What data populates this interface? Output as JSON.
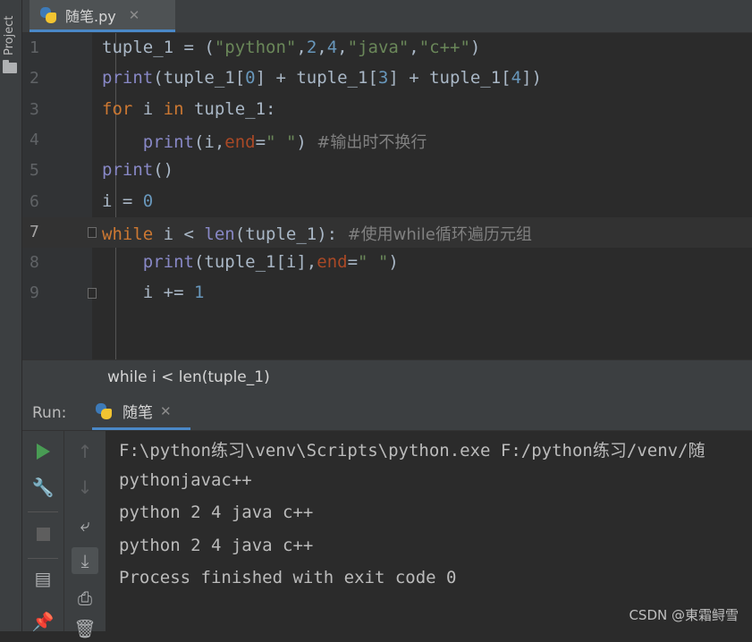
{
  "sidebar": {
    "project_label": "Project"
  },
  "editor_tab": {
    "filename": "随笔.py",
    "close": "✕"
  },
  "editor": {
    "current_line": 7,
    "lines": [
      {
        "n": "1",
        "tokens": [
          [
            "t",
            "tuple_1 = ("
          ],
          [
            "s",
            "\"python\""
          ],
          [
            "t",
            ","
          ],
          [
            "n",
            "2"
          ],
          [
            "t",
            ","
          ],
          [
            "n",
            "4"
          ],
          [
            "t",
            ","
          ],
          [
            "s",
            "\"java\""
          ],
          [
            "t",
            ","
          ],
          [
            "s",
            "\"c++\""
          ],
          [
            "t",
            ")"
          ]
        ]
      },
      {
        "n": "2",
        "tokens": [
          [
            "b",
            "print"
          ],
          [
            "t",
            "(tuple_1["
          ],
          [
            "n",
            "0"
          ],
          [
            "t",
            "] + tuple_1["
          ],
          [
            "n",
            "3"
          ],
          [
            "t",
            "] + tuple_1["
          ],
          [
            "n",
            "4"
          ],
          [
            "t",
            "])"
          ]
        ]
      },
      {
        "n": "3",
        "tokens": [
          [
            "k",
            "for"
          ],
          [
            "t",
            " i "
          ],
          [
            "k",
            "in"
          ],
          [
            "t",
            " tuple_1:"
          ]
        ]
      },
      {
        "n": "4",
        "tokens": [
          [
            "t",
            "    "
          ],
          [
            "b",
            "print"
          ],
          [
            "t",
            "(i,"
          ],
          [
            "a",
            "end"
          ],
          [
            "t",
            "="
          ],
          [
            "s",
            "\" \""
          ],
          [
            "t",
            ") "
          ],
          [
            "c",
            "#输出时不换行"
          ]
        ]
      },
      {
        "n": "5",
        "tokens": [
          [
            "b",
            "print"
          ],
          [
            "t",
            "()"
          ]
        ]
      },
      {
        "n": "6",
        "tokens": [
          [
            "t",
            "i = "
          ],
          [
            "n",
            "0"
          ]
        ]
      },
      {
        "n": "7",
        "tokens": [
          [
            "k",
            "while"
          ],
          [
            "t",
            " i < "
          ],
          [
            "b",
            "len"
          ],
          [
            "t",
            "(tuple_1): "
          ],
          [
            "c",
            "#使用while循环遍历元组"
          ]
        ]
      },
      {
        "n": "8",
        "tokens": [
          [
            "t",
            "    "
          ],
          [
            "b",
            "print"
          ],
          [
            "t",
            "(tuple_1[i],"
          ],
          [
            "a",
            "end"
          ],
          [
            "t",
            "="
          ],
          [
            "s",
            "\" \""
          ],
          [
            "t",
            ")"
          ]
        ]
      },
      {
        "n": "9",
        "tokens": [
          [
            "t",
            "    i += "
          ],
          [
            "n",
            "1"
          ]
        ]
      }
    ]
  },
  "breadcrumb": {
    "text": "while i < len(tuple_1)"
  },
  "run_panel": {
    "label": "Run:",
    "tab_title": "随笔",
    "tab_close": "✕",
    "output": [
      "F:\\python练习\\venv\\Scripts\\python.exe F:/python练习/venv/随",
      "pythonjavac++",
      "python 2 4 java c++",
      "python 2 4 java c++",
      "Process finished with exit code 0"
    ]
  },
  "watermark": "CSDN @東霜鲟雪",
  "colors": {
    "keyword": "#cc7832",
    "string": "#6a8759",
    "number": "#6897bb",
    "builtin": "#8888c6",
    "kwarg": "#aa4926",
    "comment": "#808080",
    "run_green": "#499c54",
    "accent_blue": "#4a88c7"
  },
  "icons": {
    "run": "play-icon",
    "wrench": "wrench-icon",
    "stop": "stop-icon",
    "layout": "layout-icon",
    "pin": "pin-icon",
    "up": "arrow-up-icon",
    "down": "arrow-down-icon",
    "softwrap": "soft-wrap-icon",
    "scroll_end": "scroll-to-end-icon",
    "print": "print-icon",
    "trash": "trash-icon"
  }
}
